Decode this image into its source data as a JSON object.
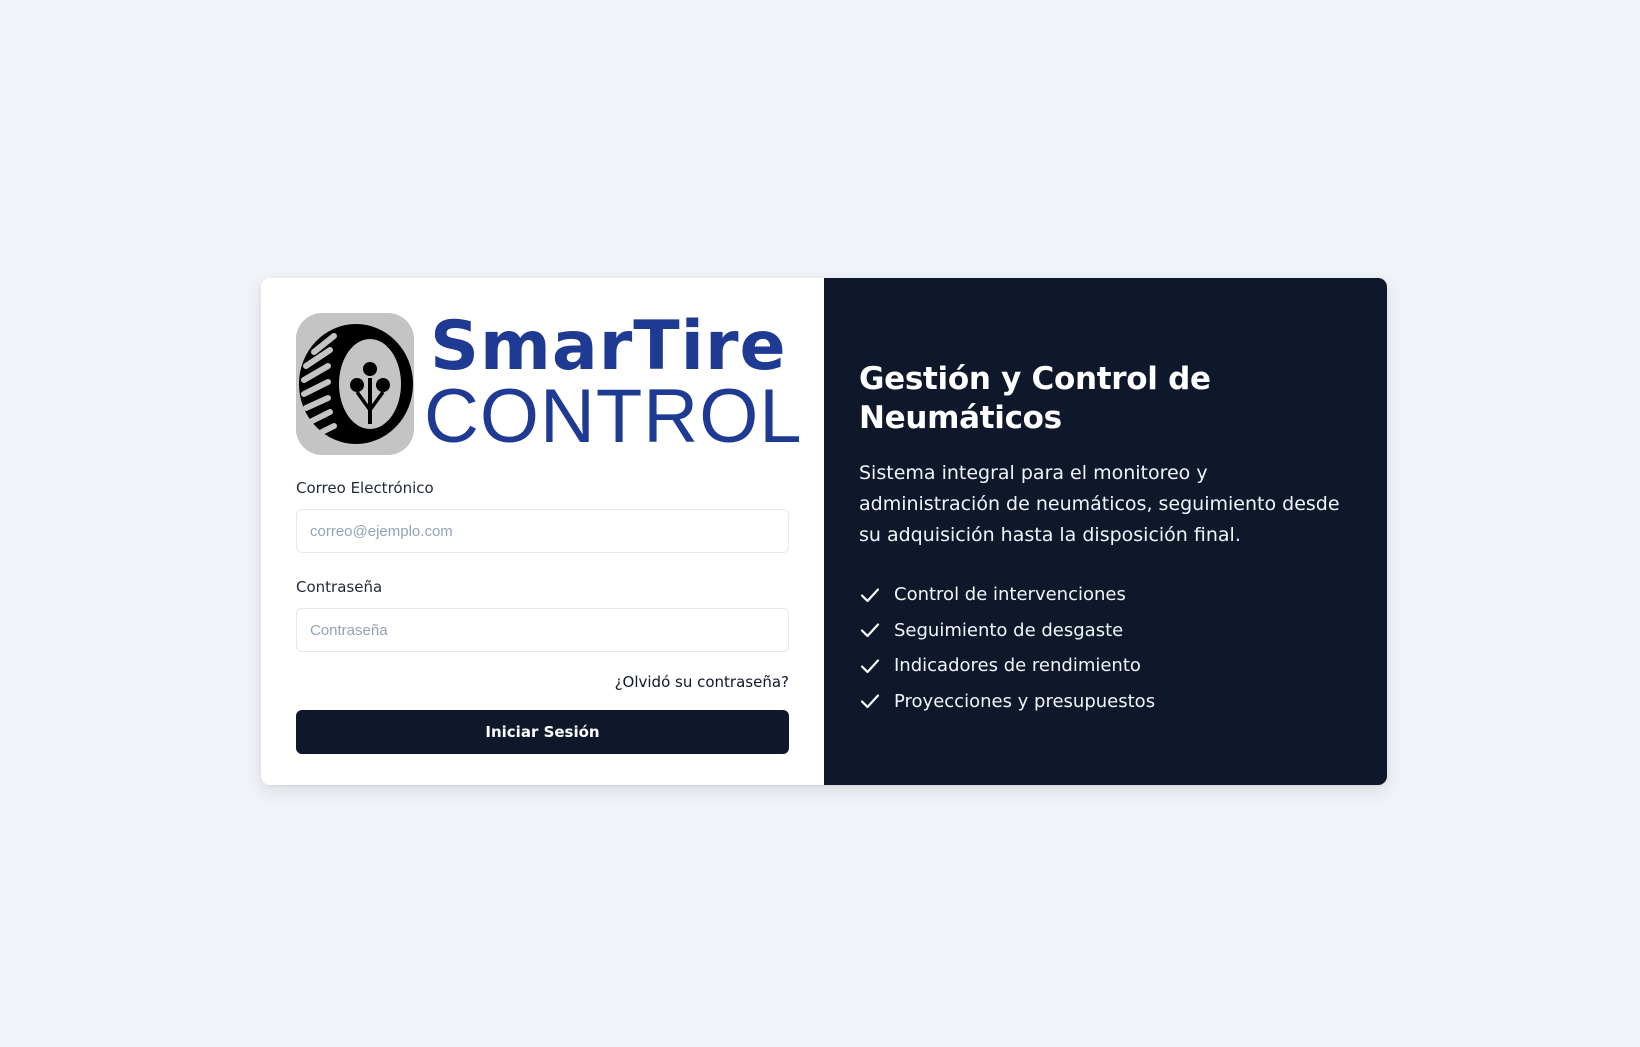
{
  "brand": {
    "line1": "SmarTire",
    "line2": "CONTROL",
    "color": "#1f3a93"
  },
  "form": {
    "email_label": "Correo Electrónico",
    "email_placeholder": "correo@ejemplo.com",
    "email_value": "",
    "password_label": "Contraseña",
    "password_placeholder": "Contraseña",
    "password_value": "",
    "forgot_link": "¿Olvidó su contraseña?",
    "submit_label": "Iniciar Sesión"
  },
  "promo": {
    "title": "Gestión y Control de Neumáticos",
    "description": "Sistema integral para el monitoreo y administración de neumáticos, seguimiento desde su adquisición hasta la disposición final.",
    "features": [
      {
        "icon": "check-icon",
        "label": "Control de intervenciones"
      },
      {
        "icon": "check-icon",
        "label": "Seguimiento de desgaste"
      },
      {
        "icon": "check-icon",
        "label": "Indicadores de rendimiento"
      },
      {
        "icon": "check-icon",
        "label": "Proyecciones y presupuestos"
      }
    ]
  },
  "colors": {
    "page_background": "#f0f4f8",
    "panel_dark": "#0f172a",
    "button": "#0f172a"
  }
}
